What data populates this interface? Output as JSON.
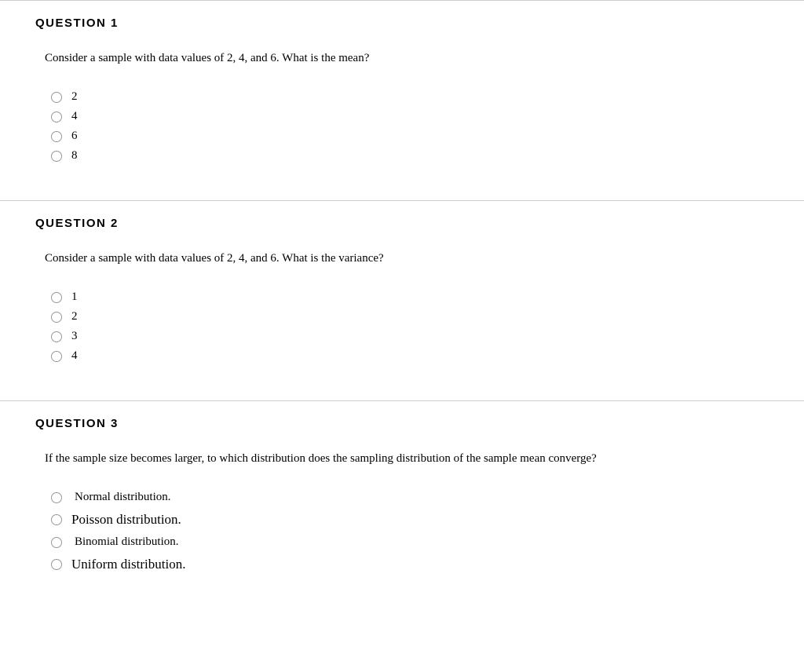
{
  "questions": [
    {
      "title": "QUESTION 1",
      "prompt": "Consider a sample with data values of 2, 4, and 6. What is the mean?",
      "options": [
        "2",
        "4",
        "6",
        "8"
      ]
    },
    {
      "title": "QUESTION 2",
      "prompt": "Consider a sample with data values of 2, 4, and 6. What is the variance?",
      "options": [
        "1",
        "2",
        "3",
        "4"
      ]
    },
    {
      "title": "QUESTION 3",
      "prompt": "If the sample size becomes larger, to which distribution does the sampling distribution of the sample mean converge?",
      "options": [
        "Normal distribution.",
        "Poisson distribution.",
        "Binomial distribution.",
        "Uniform distribution."
      ]
    }
  ]
}
